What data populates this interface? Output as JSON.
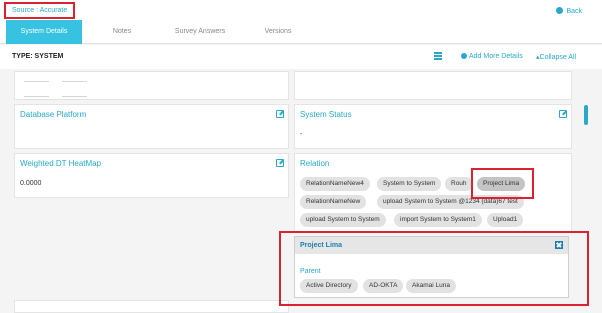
{
  "header": {
    "source_label": "Source : Accurate",
    "back_label": "Back"
  },
  "tabs": [
    {
      "label": "System Details",
      "active": true
    },
    {
      "label": "Notes",
      "active": false
    },
    {
      "label": "Survey Answers",
      "active": false
    },
    {
      "label": "Versions",
      "active": false
    }
  ],
  "toolbar": {
    "type_label": "TYPE: SYSTEM",
    "add_more_label": "Add More Details",
    "collapse_all_label": "Collapse All"
  },
  "cards": {
    "database_platform": {
      "title": "Database Platform",
      "value": ""
    },
    "system_status": {
      "title": "System Status",
      "value": "-"
    },
    "weighted_heatmap": {
      "title": "Weighted DT HeatMap",
      "value": "0.0000"
    },
    "relation": {
      "title": "Relation"
    }
  },
  "relation_chips": [
    "RelationNameNew4",
    "System to System",
    "Rouh",
    "Project Lima",
    "RelationNameNew",
    "upload System to System @1234 (data)67 test",
    "upload System to System",
    "import System to System1",
    "Upload1"
  ],
  "popup": {
    "title": "Project Lima",
    "parent_label": "Parent",
    "parents": [
      "Active Directory",
      "AD-OKTA",
      "Akamai Luna"
    ]
  },
  "colors": {
    "accent": "#29a8c9",
    "tab_active": "#36c2e0",
    "highlight": "#d9232e"
  }
}
